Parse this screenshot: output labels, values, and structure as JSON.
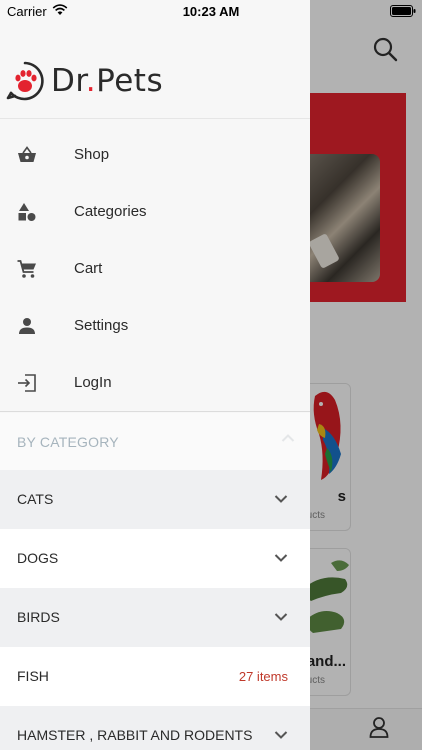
{
  "status_bar": {
    "carrier": "Carrier",
    "time": "10:23 AM"
  },
  "brand": {
    "name_part1": "Dr",
    "name_dot": ".",
    "name_part2": "Pets",
    "accent_color": "#e3232f"
  },
  "menu": [
    {
      "label": "Shop",
      "icon": "basket-icon"
    },
    {
      "label": "Categories",
      "icon": "shapes-icon"
    },
    {
      "label": "Cart",
      "icon": "cart-icon"
    },
    {
      "label": "Settings",
      "icon": "person-icon"
    },
    {
      "label": "LogIn",
      "icon": "login-icon"
    }
  ],
  "by_category": {
    "title": "BY CATEGORY",
    "items": [
      {
        "label": "CATS"
      },
      {
        "label": "DOGS"
      },
      {
        "label": "BIRDS"
      },
      {
        "label": "FISH",
        "count": "27 items"
      },
      {
        "label": "HAMSTER , RABBIT AND RODENTS"
      }
    ]
  },
  "background": {
    "card1": {
      "title": "s",
      "subtitle": "ucts"
    },
    "card2": {
      "title": "and...",
      "subtitle": "ucts"
    }
  }
}
